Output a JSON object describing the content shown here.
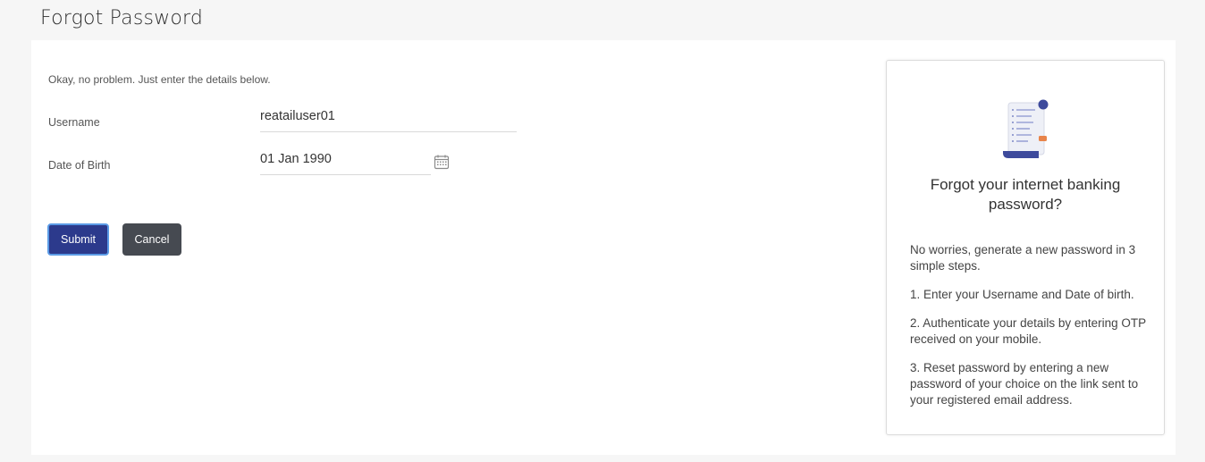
{
  "header": {
    "title": "Forgot Password"
  },
  "form": {
    "intro": "Okay, no problem. Just enter the details below.",
    "username": {
      "label": "Username",
      "value": "reatailuser01"
    },
    "dob": {
      "label": "Date of Birth",
      "value": "01 Jan 1990",
      "icon": "calendar-icon"
    },
    "submit_label": "Submit",
    "cancel_label": "Cancel"
  },
  "info": {
    "illustration": "document-icon",
    "title": "Forgot your internet banking password?",
    "lead": "No worries, generate a new password in 3 simple steps.",
    "steps": [
      "1. Enter your Username and Date of birth.",
      "2. Authenticate your details by entering OTP received on your mobile.",
      "3. Reset password by entering a new password of your choice on the link sent to your registered email address."
    ]
  },
  "colors": {
    "primary": "#2c3a8c",
    "secondary": "#464a51",
    "focus_ring": "#5b9be6",
    "accent": "#e8844a"
  }
}
